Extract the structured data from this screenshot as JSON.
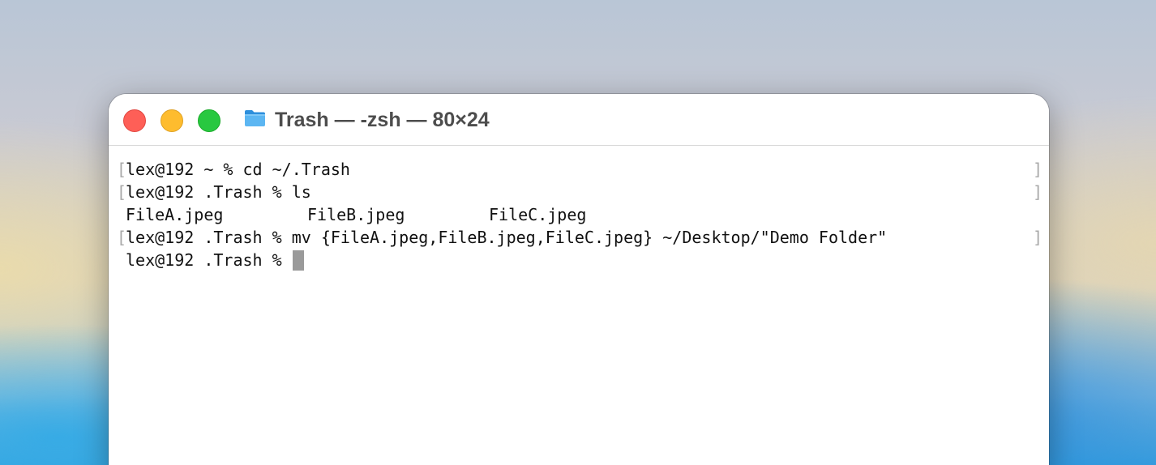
{
  "window": {
    "title": "Trash — -zsh — 80×24",
    "folder_icon": "folder-icon"
  },
  "terminal": {
    "lines": [
      {
        "text": "lex@192 ~ % cd ~/.Trash",
        "bracketed": true
      },
      {
        "text": "lex@192 .Trash % ls",
        "bracketed": true
      },
      {
        "files": [
          "FileA.jpeg",
          "FileB.jpeg",
          "FileC.jpeg"
        ],
        "bracketed": false
      },
      {
        "text": "lex@192 .Trash % mv {FileA.jpeg,FileB.jpeg,FileC.jpeg} ~/Desktop/\"Demo Folder\"",
        "bracketed": true
      },
      {
        "text": "lex@192 .Trash % ",
        "bracketed": false,
        "cursor": true
      }
    ],
    "bracket_left": "[",
    "bracket_right": "]"
  },
  "colors": {
    "close": "#fe5f57",
    "minimize": "#febc2e",
    "maximize": "#28c840",
    "folder": "#3aa0e8"
  }
}
